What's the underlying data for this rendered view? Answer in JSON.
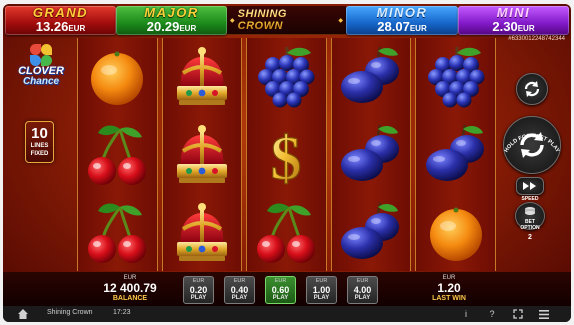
{
  "jackpots": [
    {
      "id": "grand",
      "name": "GRAND",
      "value": "13.26",
      "currency": "EUR"
    },
    {
      "id": "major",
      "name": "MAJOR",
      "value": "20.29",
      "currency": "EUR"
    },
    {
      "id": "minor",
      "name": "MINOR",
      "value": "28.07",
      "currency": "EUR"
    },
    {
      "id": "mini",
      "name": "MINI",
      "value": "2.30",
      "currency": "EUR"
    }
  ],
  "title": "SHINING CROWN",
  "game_id": "#6330012248742344",
  "logo": {
    "line1": "CLOVER",
    "line2": "Chance"
  },
  "lines": {
    "count": "10",
    "label1": "LINES",
    "label2": "FIXED"
  },
  "reels": [
    [
      "orange-icon",
      "cherries-icon",
      "cherries-icon"
    ],
    [
      "crown-icon",
      "crown-icon",
      "crown-icon"
    ],
    [
      "grapes-icon",
      "dollar-icon",
      "cherries-icon"
    ],
    [
      "plums-icon",
      "plums-icon",
      "plums-icon"
    ],
    [
      "grapes-icon",
      "plums-icon",
      "orange-icon"
    ]
  ],
  "controls": {
    "hold_label": "HOLD FOR FAST PLAY",
    "speed_label": "SPEED",
    "bet_option_label1": "BET",
    "bet_option_label2": "OPTION",
    "bet_option_value": "2"
  },
  "balance": {
    "currency": "EUR",
    "value": "12 400.79",
    "label": "BALANCE"
  },
  "bets": [
    {
      "currency": "EUR",
      "value": "0.20",
      "label": "PLAY",
      "selected": false
    },
    {
      "currency": "EUR",
      "value": "0.40",
      "label": "PLAY",
      "selected": false
    },
    {
      "currency": "EUR",
      "value": "0.60",
      "label": "PLAY",
      "selected": true
    },
    {
      "currency": "EUR",
      "value": "1.00",
      "label": "PLAY",
      "selected": false
    },
    {
      "currency": "EUR",
      "value": "4.00",
      "label": "PLAY",
      "selected": false
    }
  ],
  "last_win": {
    "currency": "EUR",
    "value": "1.20",
    "label": "LAST WIN"
  },
  "system_bar": {
    "game_name": "Shining Crown",
    "time": "17:23",
    "info_icon": "i",
    "help_icon": "?"
  },
  "colors": {
    "accent_gold": "#f3c34a",
    "selected_bet": "#3a8f2e"
  }
}
